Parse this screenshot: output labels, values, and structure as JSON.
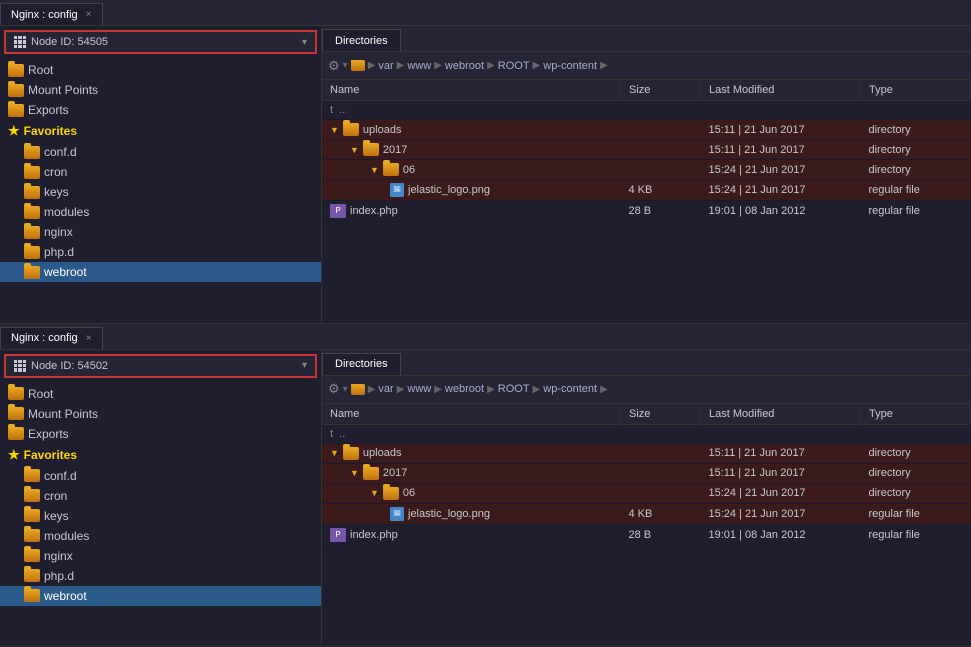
{
  "panels": [
    {
      "id": "panel-top",
      "tab": {
        "label": "Nginx : config",
        "active": true
      },
      "sidebar": {
        "nodeId": "Node ID: 54505",
        "treeItems": [
          {
            "id": "root",
            "label": "Root",
            "indent": 0,
            "type": "folder",
            "selected": false
          },
          {
            "id": "mountpoints",
            "label": "Mount Points",
            "indent": 0,
            "type": "folder",
            "selected": false
          },
          {
            "id": "exports",
            "label": "Exports",
            "indent": 0,
            "type": "folder",
            "selected": false
          },
          {
            "id": "favorites-header",
            "label": "Favorites",
            "indent": 0,
            "type": "star",
            "selected": false
          },
          {
            "id": "confd",
            "label": "conf.d",
            "indent": 1,
            "type": "folder",
            "selected": false
          },
          {
            "id": "cron",
            "label": "cron",
            "indent": 1,
            "type": "folder",
            "selected": false
          },
          {
            "id": "keys",
            "label": "keys",
            "indent": 1,
            "type": "folder",
            "selected": false
          },
          {
            "id": "modules",
            "label": "modules",
            "indent": 1,
            "type": "folder",
            "selected": false
          },
          {
            "id": "nginx",
            "label": "nginx",
            "indent": 1,
            "type": "folder",
            "selected": false
          },
          {
            "id": "phpdot",
            "label": "php.d",
            "indent": 1,
            "type": "folder",
            "selected": false
          },
          {
            "id": "webroot",
            "label": "webroot",
            "indent": 1,
            "type": "folder",
            "selected": true
          }
        ]
      },
      "fileBrowser": {
        "tabLabel": "Directories",
        "breadcrumb": [
          "var",
          "www",
          "webroot",
          "ROOT",
          "wp-content"
        ],
        "columns": [
          "Name",
          "Size",
          "Last Modified",
          "Type"
        ],
        "rows": [
          {
            "name": "..",
            "indent": 0,
            "type": "parent",
            "size": "",
            "modified": "",
            "filetype": ""
          },
          {
            "name": "uploads",
            "indent": 0,
            "type": "folder",
            "expanded": true,
            "highlighted": true,
            "size": "",
            "modified": "15:11 | 21 Jun 2017",
            "filetype": "directory"
          },
          {
            "name": "2017",
            "indent": 1,
            "type": "folder",
            "expanded": true,
            "highlighted": true,
            "size": "",
            "modified": "15:11 | 21 Jun 2017",
            "filetype": "directory"
          },
          {
            "name": "06",
            "indent": 2,
            "type": "folder",
            "expanded": true,
            "highlighted": true,
            "size": "",
            "modified": "15:24 | 21 Jun 2017",
            "filetype": "directory"
          },
          {
            "name": "jelastic_logo.png",
            "indent": 3,
            "type": "png",
            "highlighted": true,
            "size": "4 KB",
            "modified": "15:24 | 21 Jun 2017",
            "filetype": "regular file"
          },
          {
            "name": "index.php",
            "indent": 0,
            "type": "php",
            "highlighted": false,
            "size": "28 B",
            "modified": "19:01 | 08 Jan 2012",
            "filetype": "regular file"
          }
        ]
      }
    },
    {
      "id": "panel-bottom",
      "tab": {
        "label": "Nginx : config",
        "active": true
      },
      "sidebar": {
        "nodeId": "Node ID: 54502",
        "treeItems": [
          {
            "id": "root2",
            "label": "Root",
            "indent": 0,
            "type": "folder",
            "selected": false
          },
          {
            "id": "mountpoints2",
            "label": "Mount Points",
            "indent": 0,
            "type": "folder",
            "selected": false
          },
          {
            "id": "exports2",
            "label": "Exports",
            "indent": 0,
            "type": "folder",
            "selected": false
          },
          {
            "id": "favorites-header2",
            "label": "Favorites",
            "indent": 0,
            "type": "star",
            "selected": false
          },
          {
            "id": "confd2",
            "label": "conf.d",
            "indent": 1,
            "type": "folder",
            "selected": false
          },
          {
            "id": "cron2",
            "label": "cron",
            "indent": 1,
            "type": "folder",
            "selected": false
          },
          {
            "id": "keys2",
            "label": "keys",
            "indent": 1,
            "type": "folder",
            "selected": false
          },
          {
            "id": "modules2",
            "label": "modules",
            "indent": 1,
            "type": "folder",
            "selected": false
          },
          {
            "id": "nginx2",
            "label": "nginx",
            "indent": 1,
            "type": "folder",
            "selected": false
          },
          {
            "id": "phpdot2",
            "label": "php.d",
            "indent": 1,
            "type": "folder",
            "selected": false
          },
          {
            "id": "webroot2",
            "label": "webroot",
            "indent": 1,
            "type": "folder",
            "selected": true
          }
        ]
      },
      "fileBrowser": {
        "tabLabel": "Directories",
        "breadcrumb": [
          "var",
          "www",
          "webroot",
          "ROOT",
          "wp-content"
        ],
        "columns": [
          "Name",
          "Size",
          "Last Modified",
          "Type"
        ],
        "rows": [
          {
            "name": "..",
            "indent": 0,
            "type": "parent",
            "size": "",
            "modified": "",
            "filetype": ""
          },
          {
            "name": "uploads",
            "indent": 0,
            "type": "folder",
            "expanded": true,
            "highlighted": true,
            "size": "",
            "modified": "15:11 | 21 Jun 2017",
            "filetype": "directory"
          },
          {
            "name": "2017",
            "indent": 1,
            "type": "folder",
            "expanded": true,
            "highlighted": true,
            "size": "",
            "modified": "15:11 | 21 Jun 2017",
            "filetype": "directory"
          },
          {
            "name": "06",
            "indent": 2,
            "type": "folder",
            "expanded": true,
            "highlighted": true,
            "size": "",
            "modified": "15:24 | 21 Jun 2017",
            "filetype": "directory"
          },
          {
            "name": "jelastic_logo.png",
            "indent": 3,
            "type": "png",
            "highlighted": true,
            "size": "4 KB",
            "modified": "15:24 | 21 Jun 2017",
            "filetype": "regular file"
          },
          {
            "name": "index.php",
            "indent": 0,
            "type": "php",
            "highlighted": false,
            "size": "28 B",
            "modified": "19:01 | 08 Jan 2012",
            "filetype": "regular file"
          }
        ]
      }
    }
  ],
  "icons": {
    "close": "×",
    "gear": "⚙",
    "arrow_right": "▶",
    "triangle_down": "▼",
    "triangle_right": "▶",
    "star": "★",
    "dropdown": "▾",
    "grid": "⊞"
  }
}
